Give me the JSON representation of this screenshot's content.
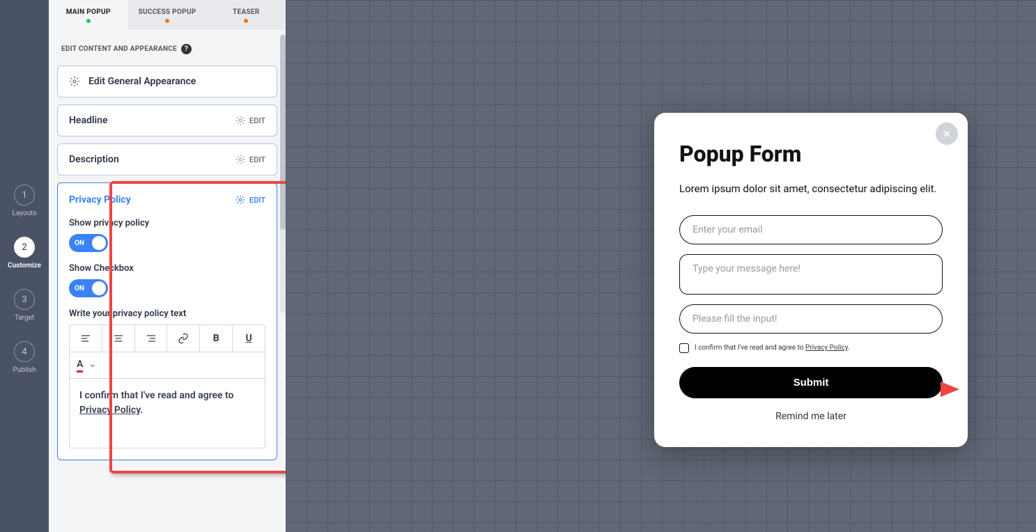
{
  "left_nav": {
    "steps": [
      {
        "num": "1",
        "label": "Layouts"
      },
      {
        "num": "2",
        "label": "Customize"
      },
      {
        "num": "3",
        "label": "Target"
      },
      {
        "num": "4",
        "label": "Publish"
      }
    ],
    "active_index": 1
  },
  "tabs": [
    {
      "label": "MAIN POPUP",
      "dot": "green"
    },
    {
      "label": "SUCCESS POPUP",
      "dot": "orange"
    },
    {
      "label": "TEASER",
      "dot": "orange"
    }
  ],
  "active_tab_index": 0,
  "panel_heading": "EDIT CONTENT AND APPEARANCE",
  "cards": {
    "general": "Edit General Appearance",
    "headline": "Headline",
    "description": "Description",
    "privacy": "Privacy Policy",
    "edit_label": "EDIT"
  },
  "privacy_panel": {
    "show_policy_label": "Show privacy policy",
    "show_checkbox_label": "Show Checkbox",
    "toggle_on": "ON",
    "write_label": "Write your privacy policy text",
    "editor_text_prefix": "I confirm that I've read and agree to ",
    "editor_link_text": "Privacy Policy",
    "editor_text_suffix": "."
  },
  "popup": {
    "title": "Popup Form",
    "description": "Lorem ipsum dolor sit amet, consectetur adipiscing elit.",
    "email_placeholder": "Enter your email",
    "message_placeholder": "Type your message here!",
    "input3_placeholder": "Please fill the input!",
    "checkbox_prefix": "I confirm that I've read and agree to ",
    "checkbox_link": "Privacy Policy",
    "checkbox_suffix": ".",
    "submit": "Submit",
    "remind": "Remind me later"
  }
}
